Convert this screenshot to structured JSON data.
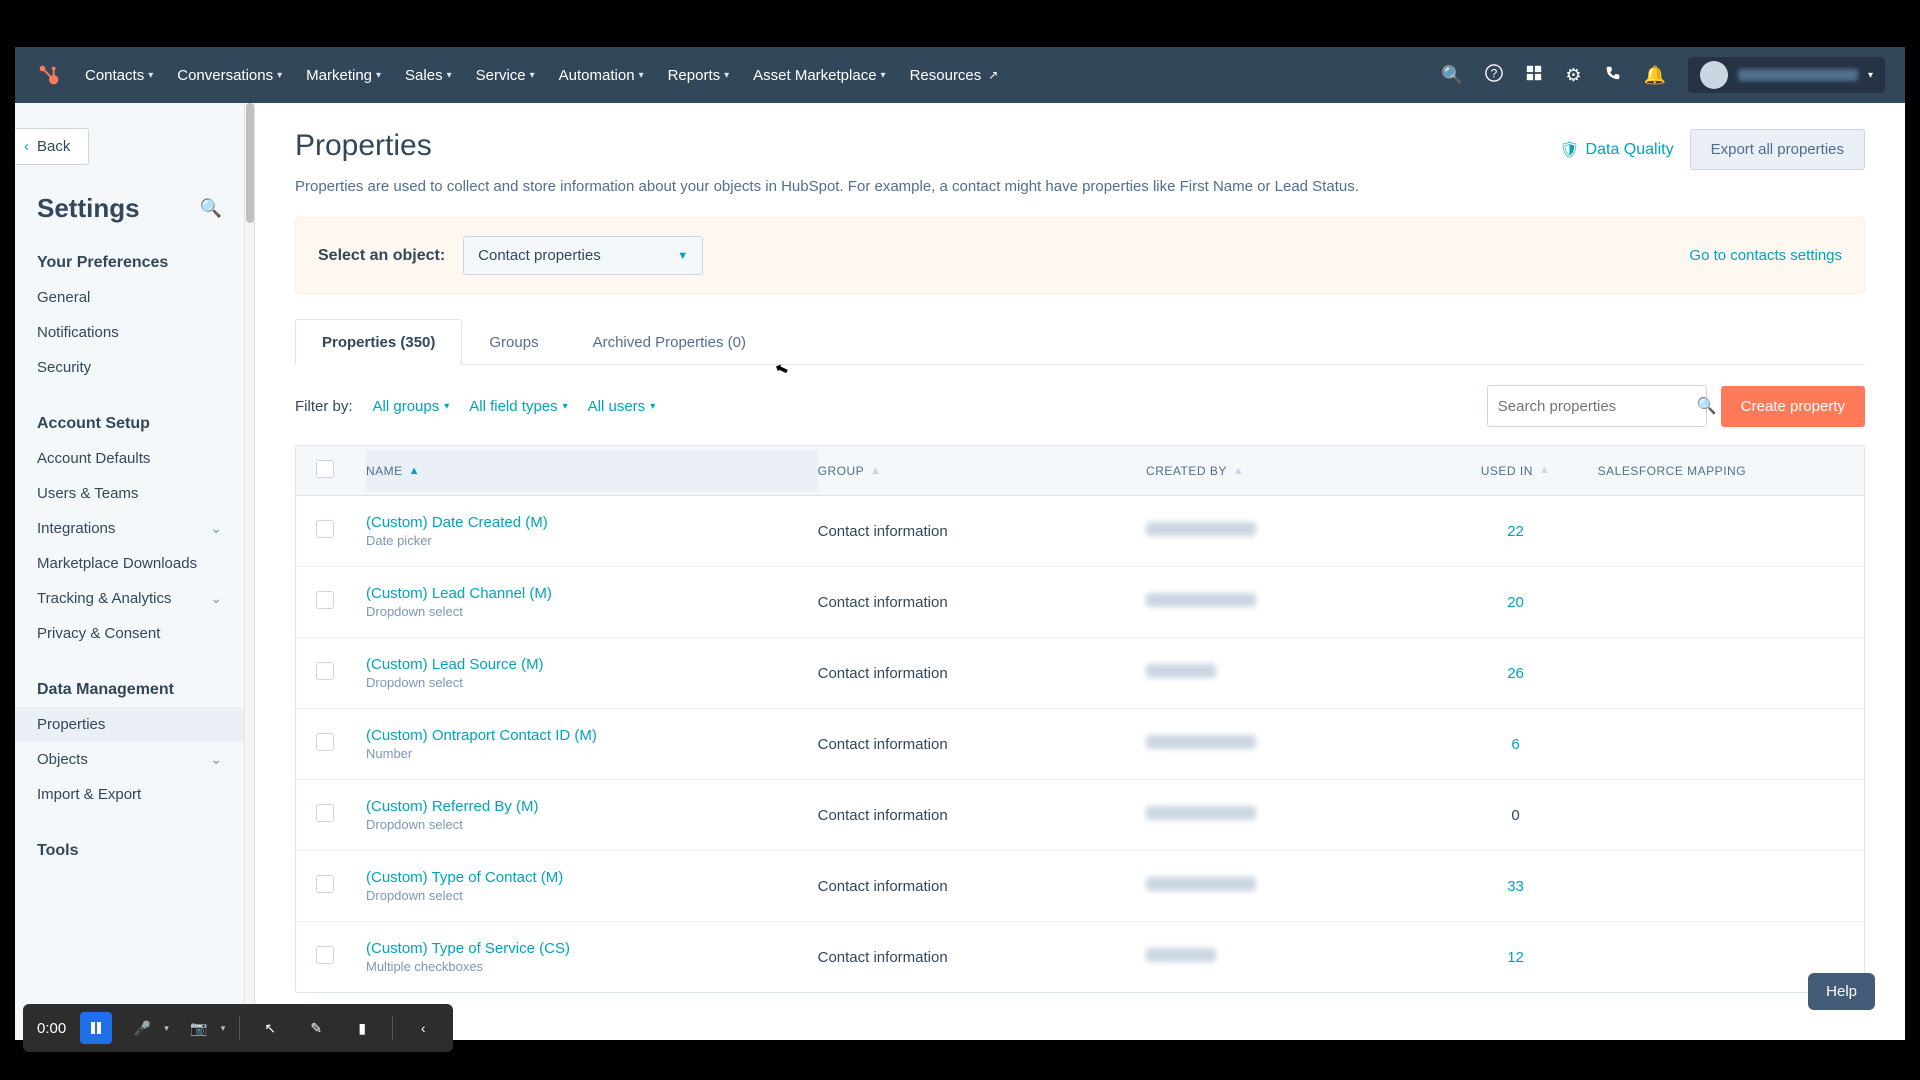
{
  "nav": {
    "items": [
      "Contacts",
      "Conversations",
      "Marketing",
      "Sales",
      "Service",
      "Automation",
      "Reports",
      "Asset Marketplace",
      "Resources"
    ]
  },
  "back_label": "Back",
  "settings_title": "Settings",
  "sidebar": {
    "prefs_title": "Your Preferences",
    "prefs": [
      "General",
      "Notifications",
      "Security"
    ],
    "account_title": "Account Setup",
    "account": [
      "Account Defaults",
      "Users & Teams",
      "Integrations",
      "Marketplace Downloads",
      "Tracking & Analytics",
      "Privacy & Consent"
    ],
    "data_title": "Data Management",
    "data": [
      "Properties",
      "Objects",
      "Import & Export"
    ],
    "tools_title": "Tools"
  },
  "page": {
    "title": "Properties",
    "desc": "Properties are used to collect and store information about your objects in HubSpot. For example, a contact might have properties like First Name or Lead Status.",
    "data_quality": "Data Quality",
    "export_btn": "Export all properties",
    "obj_label": "Select an object:",
    "obj_value": "Contact properties",
    "goto": "Go to contacts settings"
  },
  "tabs": {
    "properties": "Properties (350)",
    "groups": "Groups",
    "archived": "Archived Properties (0)"
  },
  "filters": {
    "label": "Filter by:",
    "groups": "All groups",
    "types": "All field types",
    "users": "All users",
    "search_placeholder": "Search properties",
    "create_btn": "Create property"
  },
  "columns": {
    "name": "NAME",
    "group": "GROUP",
    "created": "CREATED BY",
    "used": "USED IN",
    "sf": "SALESFORCE MAPPING"
  },
  "rows": [
    {
      "name": "(Custom) Date Created (M)",
      "type": "Date picker",
      "group": "Contact information",
      "used": "22"
    },
    {
      "name": "(Custom) Lead Channel (M)",
      "type": "Dropdown select",
      "group": "Contact information",
      "used": "20"
    },
    {
      "name": "(Custom) Lead Source (M)",
      "type": "Dropdown select",
      "group": "Contact information",
      "used": "26"
    },
    {
      "name": "(Custom) Ontraport Contact ID (M)",
      "type": "Number",
      "group": "Contact information",
      "used": "6"
    },
    {
      "name": "(Custom) Referred By (M)",
      "type": "Dropdown select",
      "group": "Contact information",
      "used": "0"
    },
    {
      "name": "(Custom) Type of Contact (M)",
      "type": "Dropdown select",
      "group": "Contact information",
      "used": "33"
    },
    {
      "name": "(Custom) Type of Service (CS)",
      "type": "Multiple checkboxes",
      "group": "Contact information",
      "used": "12"
    }
  ],
  "help_label": "Help",
  "player_time": "0:00"
}
